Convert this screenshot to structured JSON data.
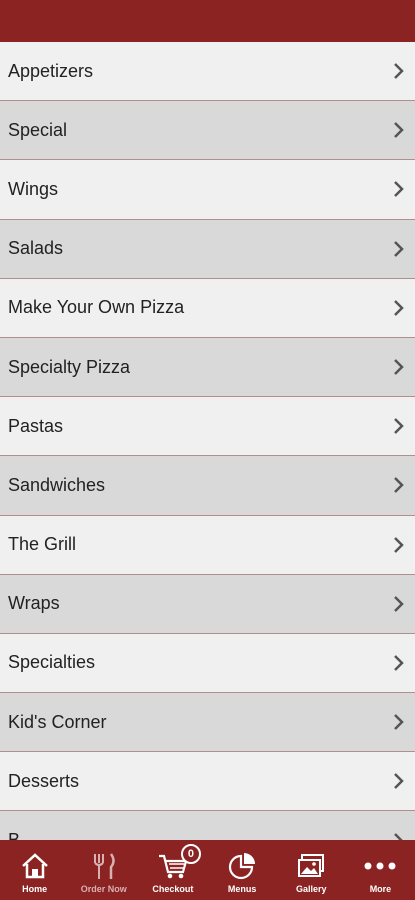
{
  "menu": {
    "items": [
      {
        "label": "Appetizers"
      },
      {
        "label": "Special"
      },
      {
        "label": "Wings"
      },
      {
        "label": "Salads"
      },
      {
        "label": "Make Your Own Pizza"
      },
      {
        "label": "Specialty Pizza"
      },
      {
        "label": "Pastas"
      },
      {
        "label": "Sandwiches"
      },
      {
        "label": "The Grill"
      },
      {
        "label": "Wraps"
      },
      {
        "label": "Specialties"
      },
      {
        "label": "Kid's Corner"
      },
      {
        "label": "Desserts"
      },
      {
        "label": "B..."
      }
    ]
  },
  "nav": {
    "home": "Home",
    "order_now": "Order Now",
    "checkout": "Checkout",
    "cart_count": "0",
    "menus": "Menus",
    "gallery": "Gallery",
    "more": "More"
  },
  "colors": {
    "brand": "#8c2323",
    "row_light": "#f0f0f0",
    "row_dark": "#d9d9d9"
  }
}
